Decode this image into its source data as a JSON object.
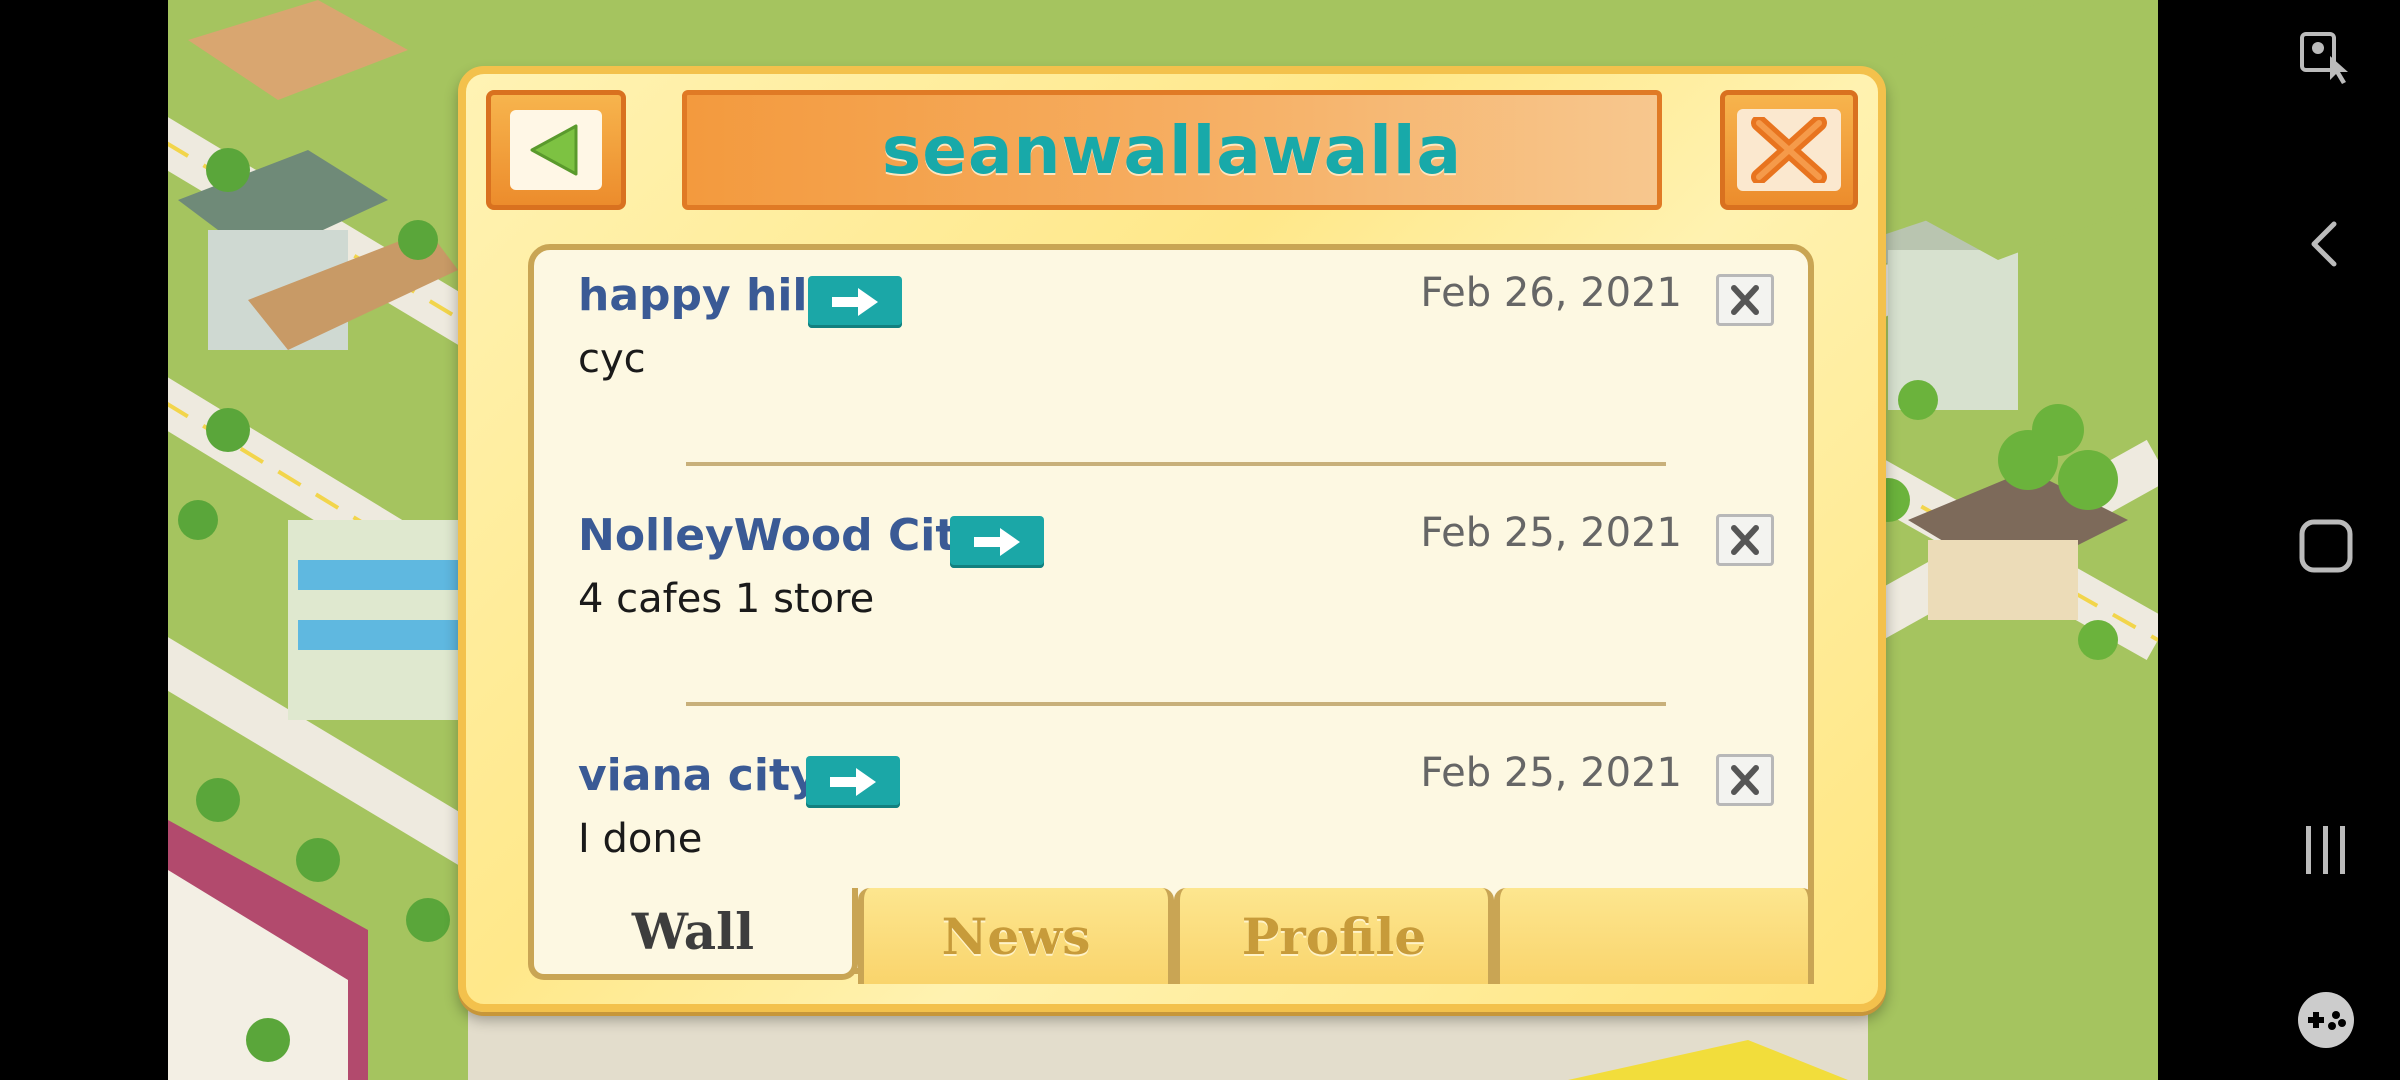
{
  "dialog": {
    "title": "seanwallawalla"
  },
  "posts": [
    {
      "author": "happy hill",
      "date": "Feb 26, 2021",
      "message": "cyc"
    },
    {
      "author": "NolleyWood City",
      "date": "Feb 25, 2021",
      "message": "4 cafes 1 store"
    },
    {
      "author": "viana city",
      "date": "Feb 25, 2021",
      "message": "I done"
    }
  ],
  "tabs": [
    {
      "label": "Wall",
      "active": true
    },
    {
      "label": "News",
      "active": false
    },
    {
      "label": "Profile",
      "active": false
    },
    {
      "label": "",
      "active": false
    }
  ],
  "colors": {
    "title_text": "#18a9a9",
    "author_text": "#3a5a95",
    "goto_button": "#1ba7a7",
    "dialog_border": "#f3c14c"
  },
  "icons": {
    "back": "back-arrow-icon",
    "close": "close-x-icon",
    "goto": "arrow-right-icon",
    "delete": "delete-x-icon",
    "nav_accessibility": "accessibility-touch-icon",
    "nav_back": "chevron-left-icon",
    "nav_home": "home-square-icon",
    "nav_recents": "recents-icon",
    "nav_game": "gamepad-icon"
  }
}
